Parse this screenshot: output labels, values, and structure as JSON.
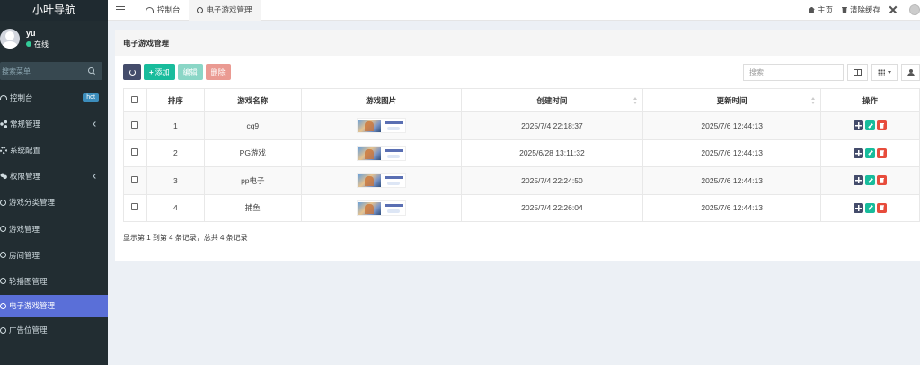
{
  "app": {
    "logo": "小叶导航"
  },
  "user": {
    "name": "yu",
    "status": "在线"
  },
  "sidebar": {
    "search_placeholder": "搜索菜单",
    "items": [
      {
        "label": "控制台",
        "badge": "hot"
      },
      {
        "label": "常规管理"
      },
      {
        "label": "系统配置"
      },
      {
        "label": "权限管理"
      },
      {
        "label": "游戏分类管理"
      },
      {
        "label": "游戏管理"
      },
      {
        "label": "房间管理"
      },
      {
        "label": "轮播图管理"
      },
      {
        "label": "电子游戏管理"
      },
      {
        "label": "广告位管理"
      }
    ]
  },
  "topbar": {
    "tabs": [
      {
        "label": "控制台"
      },
      {
        "label": "电子游戏管理"
      }
    ],
    "home": "主页",
    "clear_cache": "清除缓存"
  },
  "panel": {
    "title": "电子游戏管理"
  },
  "toolbar": {
    "add": "添加",
    "edit": "编辑",
    "delete": "删除",
    "search_placeholder": "搜索"
  },
  "table": {
    "headers": {
      "sort": "排序",
      "name": "游戏名称",
      "image": "游戏图片",
      "created": "创建时间",
      "updated": "更新时间",
      "ops": "操作"
    },
    "rows": [
      {
        "sort": "1",
        "name": "cq9",
        "created": "2025/7/4 22:18:37",
        "updated": "2025/7/6 12:44:13"
      },
      {
        "sort": "2",
        "name": "PG游戏",
        "created": "2025/6/28 13:11:32",
        "updated": "2025/7/6 12:44:13"
      },
      {
        "sort": "3",
        "name": "pp电子",
        "created": "2025/7/4 22:24:50",
        "updated": "2025/7/6 12:44:13"
      },
      {
        "sort": "4",
        "name": "捕鱼",
        "created": "2025/7/4 22:26:04",
        "updated": "2025/7/6 12:44:13"
      }
    ],
    "footer": "显示第 1 到第 4 条记录，总共 4 条记录"
  },
  "colors": {
    "sidebar_bg": "#222d32",
    "active_menu": "#5a6fd8",
    "add_button": "#18bc9c",
    "delete_button": "#e74c3c"
  }
}
